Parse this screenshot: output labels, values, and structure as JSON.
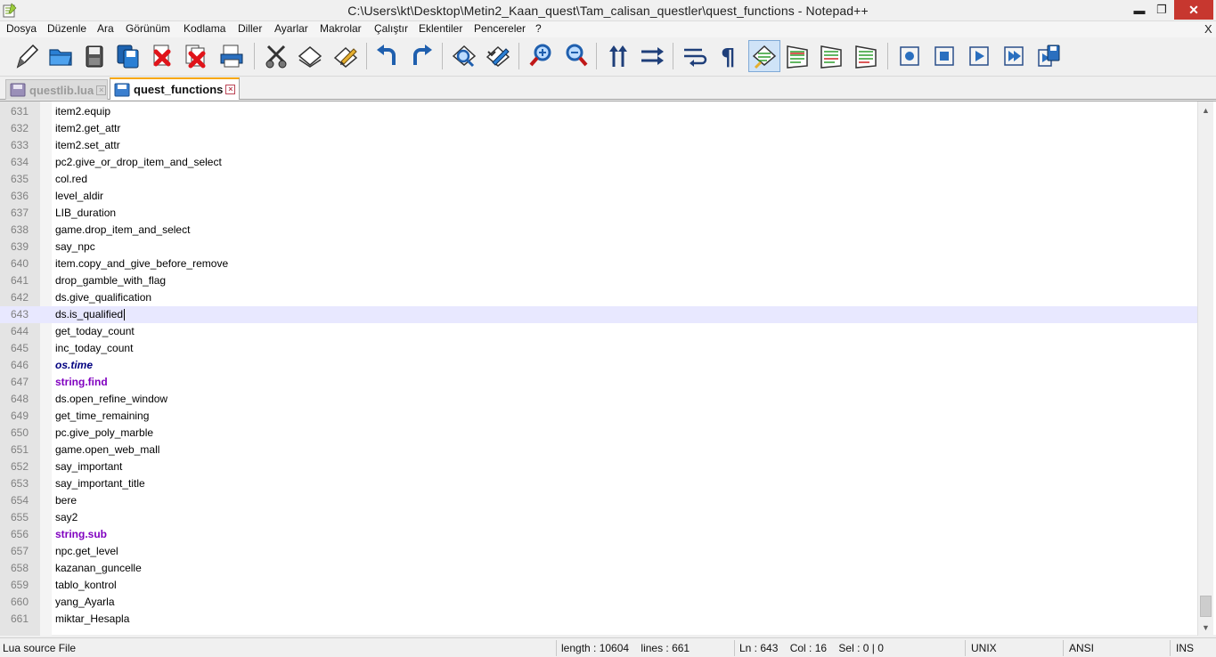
{
  "window": {
    "title": "C:\\Users\\kt\\Desktop\\Metin2_Kaan_quest\\Tam_calisan_questler\\quest_functions - Notepad++",
    "min_glyph": "▬",
    "max_glyph": "❐",
    "close_glyph": "✕"
  },
  "menu": {
    "items": [
      "Dosya",
      "Düzenle",
      "Ara",
      "Görünüm",
      "Kodlama",
      "Diller",
      "Ayarlar",
      "Makrolar",
      "Çalıştır",
      "Eklentiler",
      "Pencereler",
      "?"
    ],
    "close_glyph": "X"
  },
  "toolbar": {
    "icons": [
      "new-file-icon",
      "open-file-icon",
      "save-icon",
      "save-all-icon",
      "close-icon",
      "close-all-icon",
      "print-icon",
      "cut-icon",
      "copy-icon",
      "paste-icon",
      "undo-icon",
      "redo-icon",
      "find-icon",
      "replace-icon",
      "zoom-in-icon",
      "zoom-out-icon",
      "sync-vertical-icon",
      "sync-horizontal-icon",
      "word-wrap-icon",
      "show-all-chars-icon",
      "indent-guide-icon",
      "fold-all-icon",
      "unfold-all-icon",
      "document-map-icon",
      "record-macro-icon",
      "stop-macro-icon",
      "play-macro-icon",
      "play-multiple-macro-icon",
      "save-macro-icon"
    ],
    "active": "indent-guide-icon"
  },
  "tabs": [
    {
      "label": "questlib.lua",
      "active": false
    },
    {
      "label": "quest_functions",
      "active": true
    }
  ],
  "editor": {
    "current_line": "643",
    "lines": [
      {
        "n": "631",
        "text": "item2.equip",
        "style": "plain"
      },
      {
        "n": "632",
        "text": "item2.get_attr",
        "style": "plain"
      },
      {
        "n": "633",
        "text": "item2.set_attr",
        "style": "plain"
      },
      {
        "n": "634",
        "text": "pc2.give_or_drop_item_and_select",
        "style": "plain"
      },
      {
        "n": "635",
        "text": "col.red",
        "style": "plain"
      },
      {
        "n": "636",
        "text": "level_aldir",
        "style": "plain"
      },
      {
        "n": "637",
        "text": "LIB_duration",
        "style": "plain"
      },
      {
        "n": "638",
        "text": "game.drop_item_and_select",
        "style": "plain"
      },
      {
        "n": "639",
        "text": "say_npc",
        "style": "plain"
      },
      {
        "n": "640",
        "text": "item.copy_and_give_before_remove",
        "style": "plain"
      },
      {
        "n": "641",
        "text": "drop_gamble_with_flag",
        "style": "plain"
      },
      {
        "n": "642",
        "text": "ds.give_qualification",
        "style": "plain"
      },
      {
        "n": "643",
        "text": "ds.is_qualified",
        "style": "plain"
      },
      {
        "n": "644",
        "text": "get_today_count",
        "style": "plain"
      },
      {
        "n": "645",
        "text": "inc_today_count",
        "style": "plain"
      },
      {
        "n": "646",
        "text": "os.time",
        "style": "kw-italic"
      },
      {
        "n": "647",
        "text": "string.find",
        "style": "kw-func"
      },
      {
        "n": "648",
        "text": "ds.open_refine_window",
        "style": "plain"
      },
      {
        "n": "649",
        "text": "get_time_remaining",
        "style": "plain"
      },
      {
        "n": "650",
        "text": "pc.give_poly_marble",
        "style": "plain"
      },
      {
        "n": "651",
        "text": "game.open_web_mall",
        "style": "plain"
      },
      {
        "n": "652",
        "text": "say_important",
        "style": "plain"
      },
      {
        "n": "653",
        "text": "say_important_title",
        "style": "plain"
      },
      {
        "n": "654",
        "text": "bere",
        "style": "plain"
      },
      {
        "n": "655",
        "text": "say2",
        "style": "plain"
      },
      {
        "n": "656",
        "text": "string.sub",
        "style": "kw-func"
      },
      {
        "n": "657",
        "text": "npc.get_level",
        "style": "plain"
      },
      {
        "n": "658",
        "text": "kazanan_guncelle",
        "style": "plain"
      },
      {
        "n": "659",
        "text": "tablo_kontrol",
        "style": "plain"
      },
      {
        "n": "660",
        "text": "yang_Ayarla",
        "style": "plain"
      },
      {
        "n": "661",
        "text": "miktar_Hesapla",
        "style": "plain"
      }
    ]
  },
  "status": {
    "file_type": "Lua source File",
    "length_lines": "length : 10604    lines : 661",
    "position": "Ln : 643    Col : 16    Sel : 0 | 0",
    "eol": "UNIX",
    "encoding": "ANSI",
    "mode": "INS"
  },
  "colors": {
    "keyword_italic": "#000080",
    "keyword_function": "#8000c0",
    "current_line_bg": "#e8e8ff",
    "tab_accent": "#f7a700"
  }
}
